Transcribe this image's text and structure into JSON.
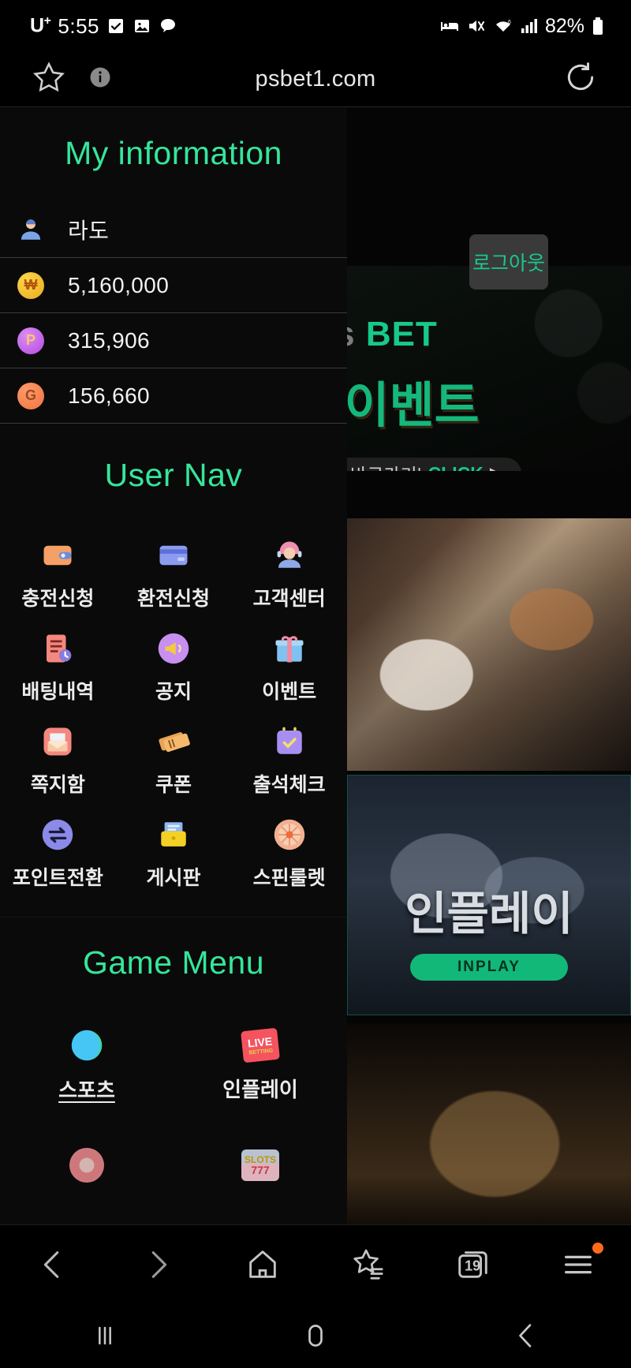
{
  "statusbar": {
    "carrier": "U",
    "carrier_sup": "+",
    "time": "5:55",
    "battery": "82%",
    "icons": [
      "checkbox-icon",
      "photo-icon",
      "kakao-icon",
      "alarm-bed-icon",
      "mute-icon",
      "wifi-icon",
      "signal-icon",
      "battery-icon"
    ]
  },
  "browser": {
    "url": "psbet1.com",
    "star_icon": "star-icon",
    "info_icon": "info-icon",
    "reload_icon": "reload-icon",
    "bottom_nav": {
      "back": "back-icon",
      "forward": "forward-icon",
      "home": "home-icon",
      "bookmarks": "bookmarks-icon",
      "tabs_count": "19",
      "menu": "menu-icon"
    }
  },
  "site": {
    "logout_label": "로그아웃",
    "banners": {
      "event": {
        "brand_gray": "lus",
        "brand_accent": "BET",
        "headline": "S 이벤트",
        "cta_prefix": "바로가기|",
        "cta_click": "CLICK"
      },
      "inplay": {
        "title": "인플레이",
        "button": "INPLAY"
      }
    }
  },
  "drawer": {
    "myinfo": {
      "title": "My information",
      "rows": [
        {
          "icon": "user-avatar-icon",
          "value": "라도"
        },
        {
          "icon": "won-coin-icon",
          "value": "5,160,000"
        },
        {
          "icon": "point-coin-icon",
          "value": "315,906"
        },
        {
          "icon": "game-money-icon",
          "value": "156,660"
        }
      ]
    },
    "usernav": {
      "title": "User Nav",
      "items": [
        {
          "label": "충전신청",
          "icon": "wallet-icon"
        },
        {
          "label": "환전신청",
          "icon": "credit-card-icon"
        },
        {
          "label": "고객센터",
          "icon": "support-agent-icon"
        },
        {
          "label": "배팅내역",
          "icon": "betting-history-icon"
        },
        {
          "label": "공지",
          "icon": "megaphone-icon"
        },
        {
          "label": "이벤트",
          "icon": "gift-icon"
        },
        {
          "label": "쪽지함",
          "icon": "mailbox-icon"
        },
        {
          "label": "쿠폰",
          "icon": "ticket-icon"
        },
        {
          "label": "출석체크",
          "icon": "calendar-check-icon"
        },
        {
          "label": "포인트전환",
          "icon": "exchange-icon"
        },
        {
          "label": "게시판",
          "icon": "folder-icon"
        },
        {
          "label": "스핀룰렛",
          "icon": "roulette-icon"
        }
      ]
    },
    "gamemenu": {
      "title": "Game Menu",
      "items": [
        {
          "label": "스포츠",
          "icon": "sports-ball-icon"
        },
        {
          "label": "인플레이",
          "icon": "live-betting-icon",
          "badge_top": "LIVE",
          "badge_bottom": "BETTING"
        },
        {
          "label": "",
          "icon": "casino-chip-icon"
        },
        {
          "label": "",
          "icon": "slots-icon",
          "slot_top": "SLOTS",
          "slot_bottom": "777"
        }
      ]
    }
  },
  "colors": {
    "accent_green": "#35e69b",
    "brand_green": "#17c98a",
    "background": "#000000",
    "drawer_bg": "#0a0a0a",
    "text": "#ececec"
  }
}
